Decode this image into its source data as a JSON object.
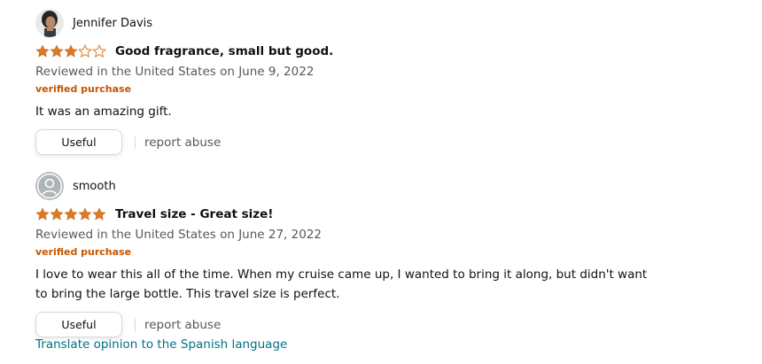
{
  "reviews": [
    {
      "reviewer": "Jennifer Davis",
      "avatar": "reviewer-photo",
      "rating": 3,
      "rating_max": 5,
      "title": "Good fragrance, small but good.",
      "date": "Reviewed in the United States on June 9, 2022",
      "verified": "verified purchase",
      "body": "It was an amazing gift.",
      "useful_label": "Useful",
      "report_label": "report abuse"
    },
    {
      "reviewer": "smooth",
      "avatar": "default-user-icon",
      "rating": 5,
      "rating_max": 5,
      "title": "Travel size - Great size!",
      "date": "Reviewed in the United States on June 27, 2022",
      "verified": "verified purchase",
      "body": "I love to wear this all of the time. When my cruise came up, I wanted to bring it along, but didn't want to bring the large bottle. This travel size is perfect.",
      "useful_label": "Useful",
      "report_label": "report abuse"
    }
  ],
  "translate_label": "Translate opinion to the Spanish language",
  "colors": {
    "star_fill": "#de7921",
    "star_empty_stroke": "#de7921",
    "verified": "#c45500",
    "link": "#007185",
    "muted": "#565959",
    "text": "#0f1111"
  }
}
